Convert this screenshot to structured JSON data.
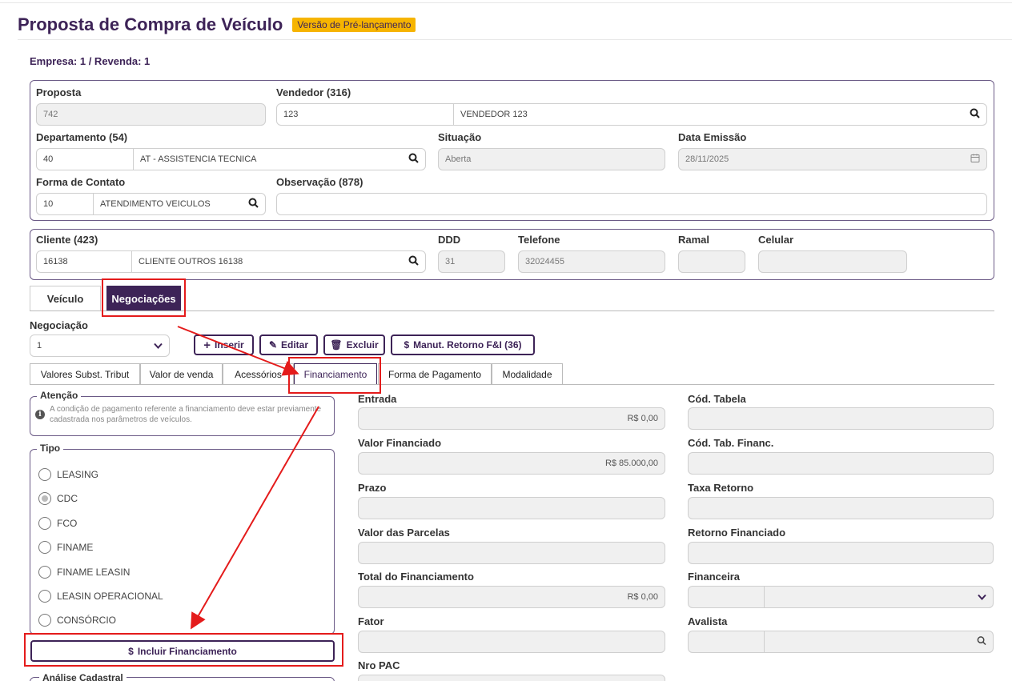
{
  "header": {
    "title": "Proposta de Compra de Veículo",
    "badge": "Versão de Pré-lançamento"
  },
  "empresa": "Empresa: 1 / Revenda: 1",
  "proposta": {
    "label": "Proposta",
    "value": "742"
  },
  "vendedor": {
    "label": "Vendedor (316)",
    "code": "123",
    "name": "VENDEDOR 123"
  },
  "departamento": {
    "label": "Departamento (54)",
    "code": "40",
    "name": "AT - ASSISTENCIA TECNICA"
  },
  "situacao": {
    "label": "Situação",
    "value": "Aberta"
  },
  "data_emissao": {
    "label": "Data Emissão",
    "value": "28/11/2025"
  },
  "forma_contato": {
    "label": "Forma de Contato",
    "code": "10",
    "name": "ATENDIMENTO VEICULOS"
  },
  "observacao": {
    "label": "Observação (878)",
    "value": ""
  },
  "cliente": {
    "label": "Cliente (423)",
    "code": "16138",
    "name": "CLIENTE OUTROS 16138"
  },
  "ddd": {
    "label": "DDD",
    "value": "31"
  },
  "telefone": {
    "label": "Telefone",
    "value": "32024455"
  },
  "ramal": {
    "label": "Ramal",
    "value": ""
  },
  "celular": {
    "label": "Celular",
    "value": ""
  },
  "main_tabs": [
    "Veículo",
    "Negociações"
  ],
  "negociacao": {
    "label": "Negociação",
    "value": "1"
  },
  "actions": {
    "inserir": "Inserir",
    "editar": "Editar",
    "excluir": "Excluir",
    "manut": "Manut. Retorno F&I (36)"
  },
  "sub_tabs": [
    "Valores Subst. Tribut",
    "Valor de venda",
    "Acessórios",
    "Financiamento",
    "Forma de Pagamento",
    "Modalidade"
  ],
  "atencao": {
    "legend": "Atenção",
    "text": "A condição de pagamento referente a financiamento deve estar previamente cadastrada nos parâmetros de veículos."
  },
  "tipo": {
    "legend": "Tipo",
    "options": [
      "LEASING",
      "CDC",
      "FCO",
      "FINAME",
      "FINAME LEASIN",
      "LEASIN OPERACIONAL",
      "CONSÓRCIO"
    ],
    "selected": "CDC"
  },
  "incluir_btn": "Incluir Financiamento",
  "analise": "Análise Cadastral",
  "fin_left": {
    "entrada": {
      "label": "Entrada",
      "value": "R$ 0,00"
    },
    "valor_financiado": {
      "label": "Valor Financiado",
      "value": "R$ 85.000,00"
    },
    "prazo": {
      "label": "Prazo",
      "value": ""
    },
    "valor_parcelas": {
      "label": "Valor das Parcelas",
      "value": ""
    },
    "total": {
      "label": "Total do Financiamento",
      "value": "R$ 0,00"
    },
    "fator": {
      "label": "Fator",
      "value": ""
    },
    "nro_pac": {
      "label": "Nro PAC",
      "value": ""
    }
  },
  "fin_right": {
    "cod_tabela": {
      "label": "Cód. Tabela"
    },
    "cod_tab_financ": {
      "label": "Cód. Tab. Financ."
    },
    "taxa_retorno": {
      "label": "Taxa Retorno"
    },
    "retorno_financiado": {
      "label": "Retorno Financiado"
    },
    "financeira": {
      "label": "Financeira"
    },
    "avalista": {
      "label": "Avalista"
    }
  },
  "colors": {
    "brand": "#3d2357",
    "badge": "#f6b400",
    "highlight": "#e41b1b"
  }
}
